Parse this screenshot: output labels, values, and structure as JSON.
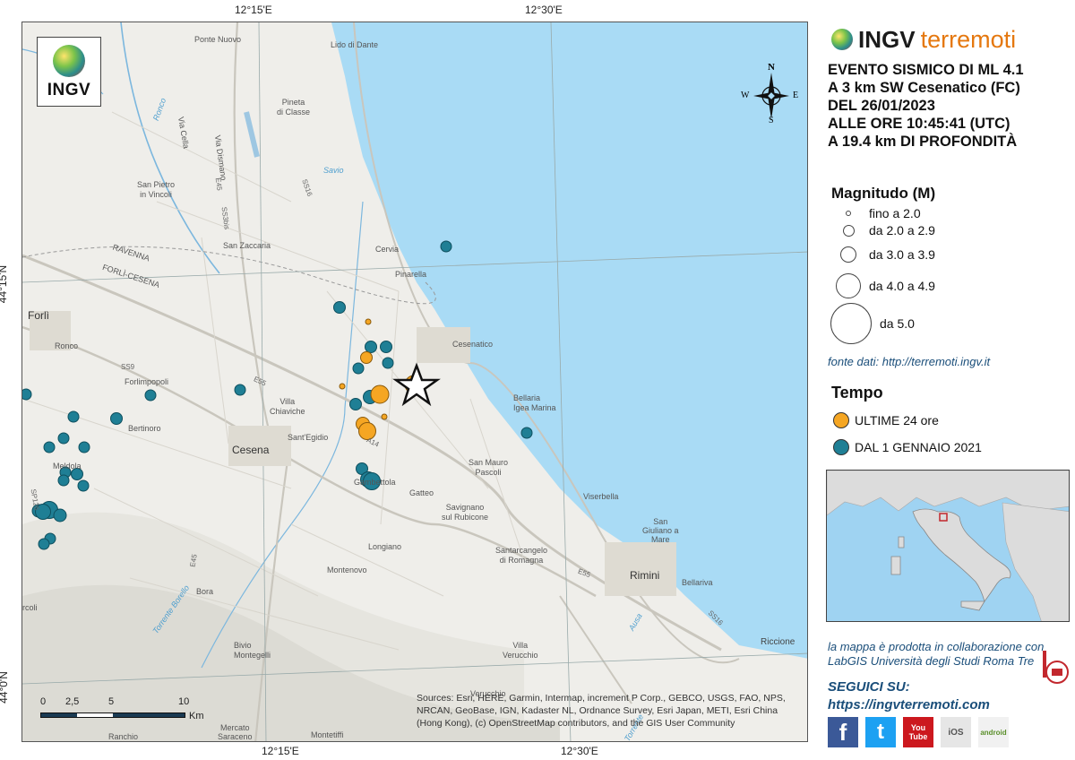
{
  "coordinates": {
    "top_left": "12°15'E",
    "top_right": "12°30'E",
    "bottom_left": "12°15'E",
    "bottom_right": "12°30'E",
    "lat_upper": "44°15'N",
    "lat_lower": "44°0'N"
  },
  "logo": {
    "text": "INGV",
    "icon": "ingv-globe-logo"
  },
  "compass": {
    "n": "N",
    "s": "S",
    "e": "E",
    "w": "W"
  },
  "places": {
    "ponte_nuovo": "Ponte Nuovo",
    "lido_di_dante": "Lido di Dante",
    "pineta_di_classe": "Pineta\ndi Classe",
    "ronco_river": "Ronco",
    "via_cella": "Via Cella",
    "via_dismano": "Via Dismano",
    "savio": "Savio",
    "san_pietro": "San Pietro\nin Vincoli",
    "san_zaccaria": "San Zaccaria",
    "ravenna": "RAVENNA",
    "forli_cesena": "FORLÌ-CESENA",
    "cervia": "Cervia",
    "pinarella": "Pinarella",
    "forli": "Forlì",
    "ronco": "Ronco",
    "forlimpopoli": "Forlimpopoli",
    "cesenatico": "Cesenatico",
    "bellaria": "Bellaria\nIgea Marina",
    "villa_chiaviche": "Villa\nChiaviche",
    "bertinoro": "Bertinoro",
    "santegidio": "Sant'Egidio",
    "cesena": "Cesena",
    "meldola": "Meldola",
    "san_mauro": "San Mauro\nPascoli",
    "gambettola": "Gambettola",
    "gatteo": "Gatteo",
    "savignano": "Savignano\nsul Rubicone",
    "viserbella": "Viserbella",
    "san_giuliano": "San\nGiuliano a\nMare",
    "longiano": "Longiano",
    "santarcangelo": "Santarcangelo\ndi Romagna",
    "rimini": "Rimini",
    "montenovo": "Montenovo",
    "bora": "Bora",
    "bellariva": "Bellariva",
    "torrente_borello": "Torrente Borello",
    "ausa": "Ausa",
    "riccione": "Riccione",
    "bivio_montegelli": "Bivio\nMontegelli",
    "villa_verucchio": "Villa\nVerucchio",
    "verucchio": "Verucchio",
    "ranchio": "Ranchio",
    "mercato_saraceno": "Mercato\nSaraceno",
    "montetiffi": "Montetiffi",
    "rocoli": "rcoli",
    "torrente": "Torrente",
    "roads": [
      "E45",
      "SS3bis",
      "SS16",
      "SS9",
      "E55",
      "A14",
      "E45",
      "E55",
      "SS16",
      "SP126"
    ]
  },
  "scalebar": {
    "ticks": [
      "0",
      "2,5",
      "5",
      "10"
    ],
    "unit": "Km"
  },
  "attribution": "Sources: Esri, HERE, Garmin, Intermap, increment P Corp., GEBCO, USGS, FAO, NPS, NRCAN, GeoBase, IGN, Kadaster NL, Ordnance Survey, Esri Japan, METI, Esri China (Hong Kong), (c) OpenStreetMap contributors, and the GIS User Community",
  "panel": {
    "brand_ingv": "INGV",
    "brand_terremoti": "terremoti",
    "event_lines": [
      "EVENTO SISMICO DI ML 4.1",
      "A 3 km SW Cesenatico (FC)",
      "DEL 26/01/2023",
      "ALLE ORE 10:45:41 (UTC)",
      "A 19.4 km DI PROFONDITÀ"
    ],
    "magnitude_title": "Magnitudo (M)",
    "magnitude_classes": [
      "fino a 2.0",
      "da 2.0 a 2.9",
      "da 3.0 a 3.9",
      "da 4.0 a 4.9",
      "da 5.0"
    ],
    "source": "fonte dati: http://terremoti.ingv.it",
    "time_title": "Tempo",
    "time_classes": [
      {
        "label": "ULTIME 24 ore",
        "color": "#f5a623"
      },
      {
        "label": "DAL 1 GENNAIO 2021",
        "color": "#1f7f95"
      }
    ],
    "collab_line1": "la mappa è prodotta in collaborazione con",
    "collab_line2": "LabGIS Università degli Studi Roma Tre",
    "follow_title": "SEGUICI SU:",
    "follow_url": "https://ingvterremoti.com",
    "social": [
      {
        "name": "facebook-icon",
        "glyph": "f",
        "color": "#3b5998"
      },
      {
        "name": "twitter-icon",
        "glyph": "t",
        "color": "#1da1f2"
      },
      {
        "name": "youtube-icon",
        "glyph": "You Tube",
        "color": "#cc181e"
      },
      {
        "name": "ios-icon",
        "glyph": "iOS",
        "color": "#e6e6e6"
      },
      {
        "name": "android-icon",
        "glyph": "android",
        "color": "#f1f1f1"
      }
    ]
  },
  "colors": {
    "recent": "#f5a623",
    "historic": "#1f7f95",
    "sea": "#a9dbf5",
    "land": "#efeeea",
    "brand_orange": "#e5780f",
    "link_blue": "#1a4e7a"
  }
}
